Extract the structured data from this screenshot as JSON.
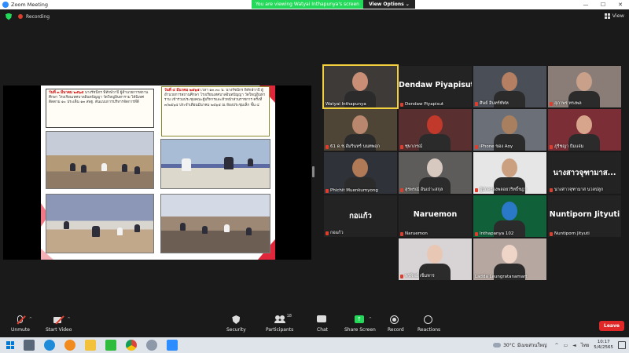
{
  "window": {
    "title": "Zoom Meeting",
    "minimize": "—",
    "maximize": "☐",
    "close": "✕"
  },
  "banner": {
    "message": "You are viewing Watyai Inthapunya's screen",
    "options": "View Options ⌄"
  },
  "status": {
    "recording": "Recording",
    "view": "View"
  },
  "slide": {
    "box1": {
      "date": "วันที่ ๓ มีนาคม ๒๕๖๕",
      "text": " นางรัชนีกร พิทักษ์วาปี ผู้อำนวยการสถานศึกษา โรงเรียนเทศบาลอินทปัญญา วัดใหญ่อินทาราม ได้นิเทศติดตาม ๑๐ ประเด็น ๑๓ สพฐ. ต้นแบบการบริหารจัดการที่ดี"
    },
    "box2": {
      "date": "วันที่ ๔ มีนาคม ๒๕๖๕",
      "text": " เวลา ๑๓.๓๐ น. นางรัชนีกร พิทักษ์วาปี ผู้อำนวยการสถานศึกษา โรงเรียนเทศบาลอินทปัญญา วัดใหญ่อินทาราม เข้าร่วมประชุมคณะผู้บริหารและหัวหน้าส่วนราชการ ครั้งที่ ๓/๒๕๖๕ ประจำเดือนมีนาคม ๒๕๖๕ ณ ห้องประชุมเล็ก ชั้น ๔"
    }
  },
  "participants": [
    {
      "name": "Watyai Inthapunya",
      "muted": false,
      "video": true,
      "active": true
    },
    {
      "name": "Dendaw Piyapisut",
      "muted": true,
      "video": false,
      "display": "Dendaw Piyapisut"
    },
    {
      "name": "ศิษย์ อินทร์ทัฬห",
      "muted": true,
      "video": true
    },
    {
      "name": "สุภาพร ทรงพล",
      "muted": true,
      "video": true
    },
    {
      "name": "61 ด.ช.อัมรินทร์ นนทพฤก",
      "muted": true,
      "video": true
    },
    {
      "name": "ชุษาภรณ์",
      "muted": true,
      "video": true
    },
    {
      "name": "iPhone ของ Aoy",
      "muted": true,
      "video": true
    },
    {
      "name": "ภูริชญา ธิมแจ่ม",
      "muted": true,
      "video": true
    },
    {
      "name": "Phichit Muenkumyong",
      "muted": true,
      "video": true
    },
    {
      "name": "สุรพรณ์ อันเปาะสกุล",
      "muted": true,
      "video": true
    },
    {
      "name": "ผู้ปกครองพลอยวริทธิ์ชฎา",
      "muted": true,
      "video": true
    },
    {
      "name": "นางสาวจุฑามาส นวลปลูก",
      "muted": true,
      "video": false,
      "display": "นางสาวจุฑามาส..."
    },
    {
      "name": "กอแก้ว",
      "muted": true,
      "video": false,
      "display": "กอแก้ว"
    },
    {
      "name": "Naruemon",
      "muted": true,
      "video": false,
      "display": "Naruemon"
    },
    {
      "name": "Inthapanya 102",
      "muted": true,
      "video": true
    },
    {
      "name": "Nuntiporn Jityuti",
      "muted": true,
      "video": false,
      "display": "Nuntiporn Jityuti"
    },
    {
      "name": "พรพิพย์ เข็มทาร",
      "muted": true,
      "video": true
    },
    {
      "name": "Ladda Leungratanamart",
      "muted": false,
      "video": true
    }
  ],
  "toolbar": {
    "unmute": "Unmute",
    "start_video": "Start Video",
    "security": "Security",
    "participants": "Participants",
    "participant_count": "18",
    "chat": "Chat",
    "share_screen": "Share Screen",
    "record": "Record",
    "reactions": "Reactions",
    "leave": "Leave",
    "caret": "^"
  },
  "taskbar": {
    "weather": "30°C",
    "weather_desc": "มีเมฆส่วนใหญ่",
    "language": "ไทย",
    "time": "10:17",
    "date": "5/4/2565",
    "tray_up": "^"
  }
}
